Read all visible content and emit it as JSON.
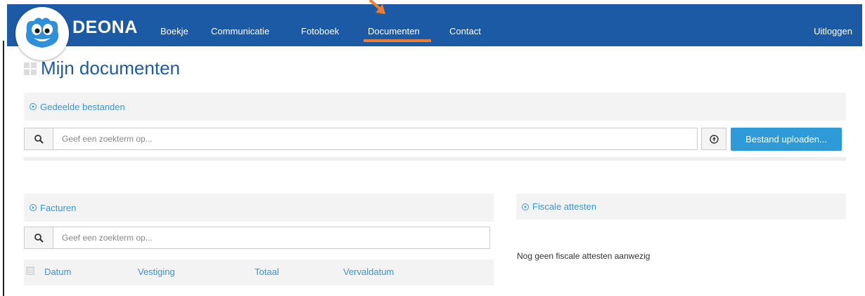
{
  "nav": {
    "brand": "DEONA",
    "items": [
      {
        "label": "Boekje",
        "active": false
      },
      {
        "label": "Communicatie",
        "active": false
      },
      {
        "label": "Fotoboek",
        "active": false
      },
      {
        "label": "Documenten",
        "active": true
      },
      {
        "label": "Contact",
        "active": false
      }
    ],
    "logout": "Uitloggen"
  },
  "colors": {
    "navbar": "#1d5aa6",
    "active_underline": "#ef7d2d",
    "accent": "#3a96d6",
    "upload_button": "#2f9ad8"
  },
  "page": {
    "title": "Mijn documenten"
  },
  "shared_files": {
    "header": "Gedeelde bestanden",
    "search_placeholder": "Geef een zoekterm op...",
    "upload_label": "Bestand uploaden..."
  },
  "invoices": {
    "header": "Facturen",
    "search_placeholder": "Geef een zoekterm op...",
    "columns": [
      "Datum",
      "Vestiging",
      "Totaal",
      "Vervaldatum"
    ]
  },
  "tax_certificates": {
    "header": "Fiscale attesten",
    "empty_message": "Nog geen fiscale attesten aanwezig"
  },
  "icons": [
    "search-icon",
    "upload-icon",
    "circle-chevron-icon",
    "list-icon",
    "grid-icon",
    "arrow-pointer-icon",
    "mascot-logo"
  ]
}
